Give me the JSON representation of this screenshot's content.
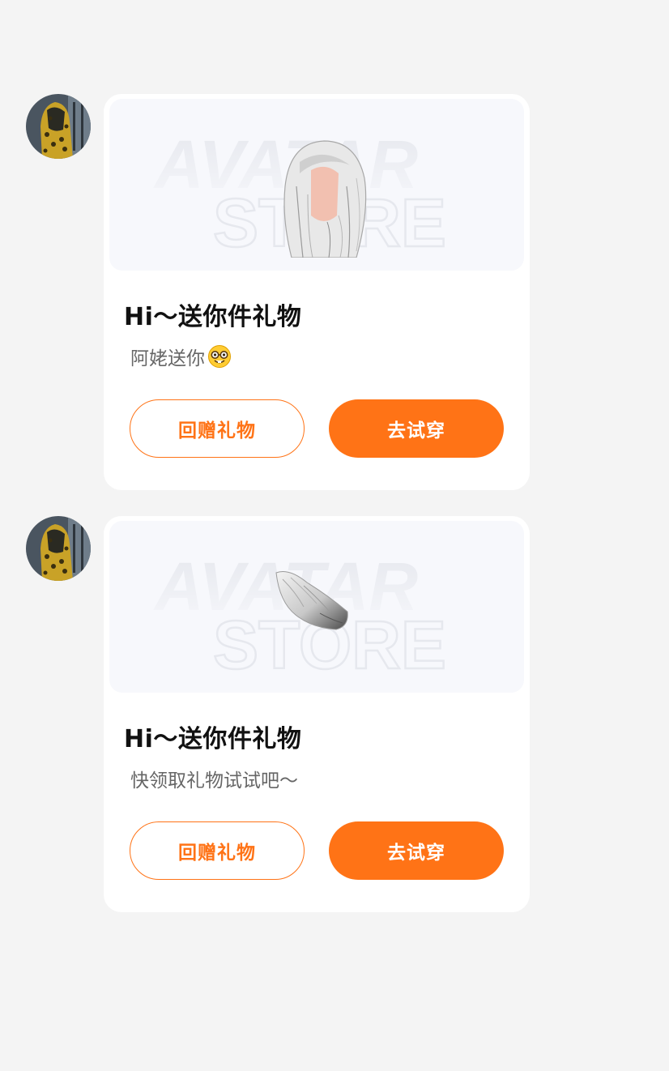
{
  "messages": [
    {
      "banner_watermark": [
        "AVATAR",
        "STORE"
      ],
      "product": "hair-wig-image",
      "title": "Hi～送你件礼物",
      "subtitle": "阿姥送你",
      "subtitle_emoji": "nerd-face-emoji",
      "return_gift_label": "回赠礼物",
      "try_on_label": "去试穿"
    },
    {
      "banner_watermark": [
        "AVATAR",
        "STORE"
      ],
      "product": "fluffy-tail-image",
      "title": "Hi～送你件礼物",
      "subtitle": "快领取礼物试试吧～",
      "return_gift_label": "回赠礼物",
      "try_on_label": "去试穿"
    }
  ],
  "colors": {
    "accent": "#ff7316",
    "background": "#f4f4f4",
    "card": "#ffffff",
    "banner": "#f7f8fc"
  }
}
